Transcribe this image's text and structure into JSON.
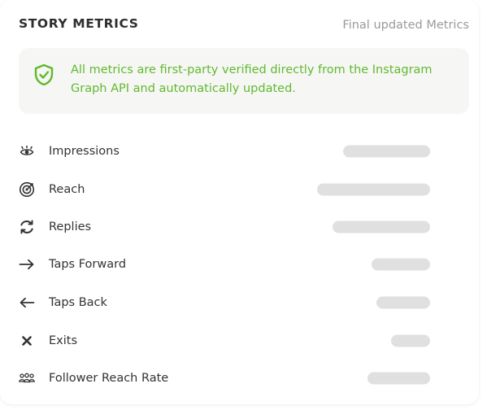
{
  "header": {
    "title": "STORY METRICS",
    "subtitle": "Final updated Metrics"
  },
  "notice": {
    "icon": "shield-check-icon",
    "text": "All metrics are first-party verified directly from the Instagram Graph API and automatically updated.",
    "color": "#62b82e"
  },
  "metrics": [
    {
      "label": "Impressions",
      "icon": "eye-icon"
    },
    {
      "label": "Reach",
      "icon": "target-icon"
    },
    {
      "label": "Replies",
      "icon": "refresh-icon"
    },
    {
      "label": "Taps Forward",
      "icon": "arrow-right-icon"
    },
    {
      "label": "Taps Back",
      "icon": "arrow-left-icon"
    },
    {
      "label": "Exits",
      "icon": "close-icon"
    },
    {
      "label": "Follower Reach Rate",
      "icon": "group-icon"
    }
  ]
}
